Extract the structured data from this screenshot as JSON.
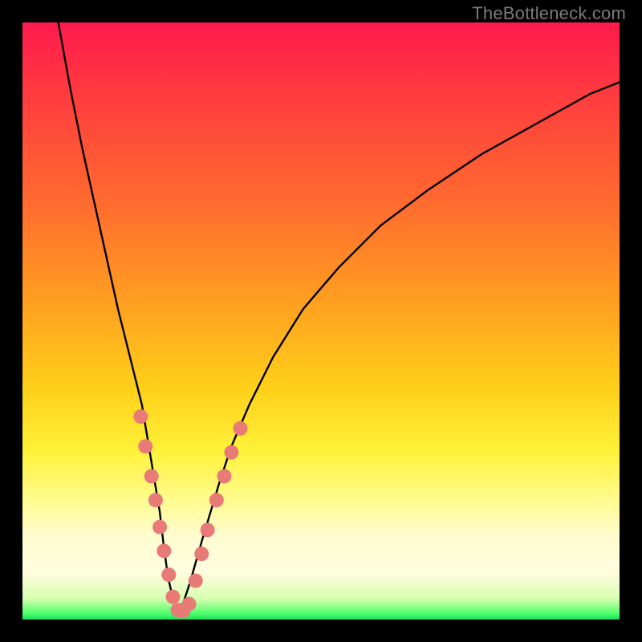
{
  "watermark": "TheBottleneck.com",
  "colors": {
    "frame": "#000000",
    "curve_stroke": "#000000",
    "dot_fill": "#e87a78",
    "gradient_top": "#ff1a4d",
    "gradient_bottom": "#18e05a"
  },
  "chart_data": {
    "type": "line",
    "title": "",
    "xlabel": "",
    "ylabel": "",
    "xlim": [
      0,
      100
    ],
    "ylim": [
      0,
      100
    ],
    "grid": false,
    "legend": false,
    "annotations": [
      "TheBottleneck.com"
    ],
    "series": [
      {
        "name": "bottleneck-curve-left",
        "x": [
          6,
          8,
          10,
          12,
          14,
          16,
          18,
          20,
          21,
          22,
          23,
          23.7,
          24.4,
          25.2,
          26
        ],
        "values": [
          100,
          89,
          79,
          70,
          61,
          52,
          44,
          36,
          30,
          24,
          18,
          12,
          7,
          3.5,
          1.2
        ]
      },
      {
        "name": "bottleneck-curve-right",
        "x": [
          26,
          27,
          28,
          29,
          30,
          31.5,
          33,
          35,
          38,
          42,
          47,
          53,
          60,
          68,
          77,
          86,
          95,
          100
        ],
        "values": [
          1.2,
          3,
          6,
          9.5,
          13,
          18,
          23,
          29,
          36,
          44,
          52,
          59,
          66,
          72,
          78,
          83,
          88,
          90
        ]
      }
    ],
    "dots": [
      {
        "name": "left-arm",
        "x": 19.8,
        "y": 34
      },
      {
        "name": "left-arm",
        "x": 20.6,
        "y": 29
      },
      {
        "name": "left-arm",
        "x": 21.6,
        "y": 24
      },
      {
        "name": "left-arm",
        "x": 22.3,
        "y": 20
      },
      {
        "name": "left-arm",
        "x": 23.0,
        "y": 15.5
      },
      {
        "name": "left-arm",
        "x": 23.7,
        "y": 11.5
      },
      {
        "name": "left-arm",
        "x": 24.5,
        "y": 7.5
      },
      {
        "name": "trough",
        "x": 25.2,
        "y": 3.8
      },
      {
        "name": "trough",
        "x": 26.0,
        "y": 1.6
      },
      {
        "name": "trough",
        "x": 26.9,
        "y": 1.4
      },
      {
        "name": "trough",
        "x": 27.9,
        "y": 2.6
      },
      {
        "name": "right-arm",
        "x": 29.0,
        "y": 6.5
      },
      {
        "name": "right-arm",
        "x": 30.0,
        "y": 11
      },
      {
        "name": "right-arm",
        "x": 31.0,
        "y": 15
      },
      {
        "name": "right-arm",
        "x": 32.5,
        "y": 20
      },
      {
        "name": "right-arm",
        "x": 33.8,
        "y": 24
      },
      {
        "name": "right-arm",
        "x": 35.0,
        "y": 28
      },
      {
        "name": "right-arm",
        "x": 36.5,
        "y": 32
      }
    ]
  }
}
